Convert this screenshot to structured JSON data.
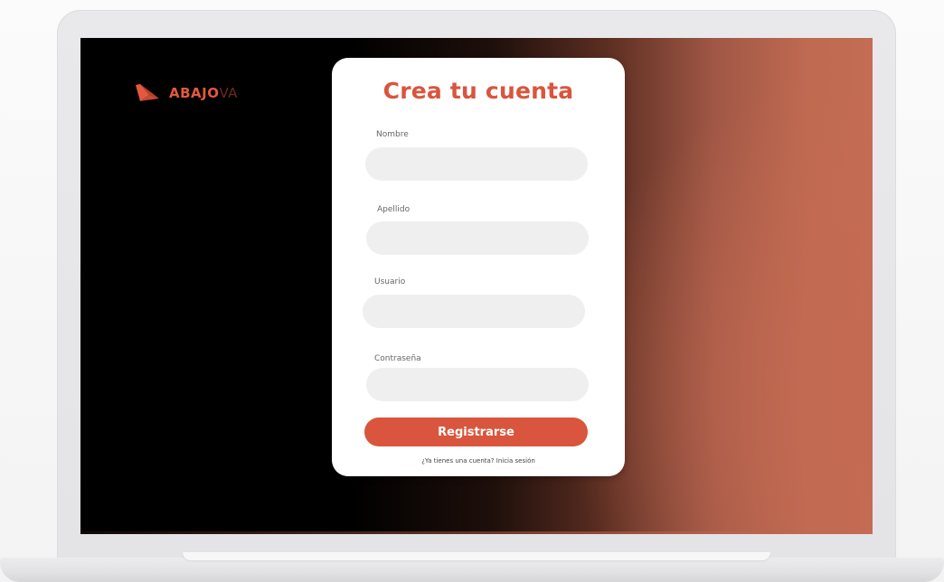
{
  "brand": {
    "name_bold": "ABAJO",
    "name_light": "VA",
    "accent_color": "#d9553d"
  },
  "form": {
    "title": "Crea tu cuenta",
    "fields": [
      {
        "label": "Nombre",
        "value": "",
        "placeholder": ""
      },
      {
        "label": "Apellido",
        "value": "",
        "placeholder": ""
      },
      {
        "label": "Usuario",
        "value": "",
        "placeholder": ""
      },
      {
        "label": "Contraseña",
        "value": "",
        "placeholder": ""
      }
    ],
    "submit_label": "Registrarse",
    "login_prompt": "¿Ya tienes una cuenta?",
    "login_link": "Inicia sesión"
  },
  "icons": {
    "logo": "abajova-logo-icon"
  }
}
